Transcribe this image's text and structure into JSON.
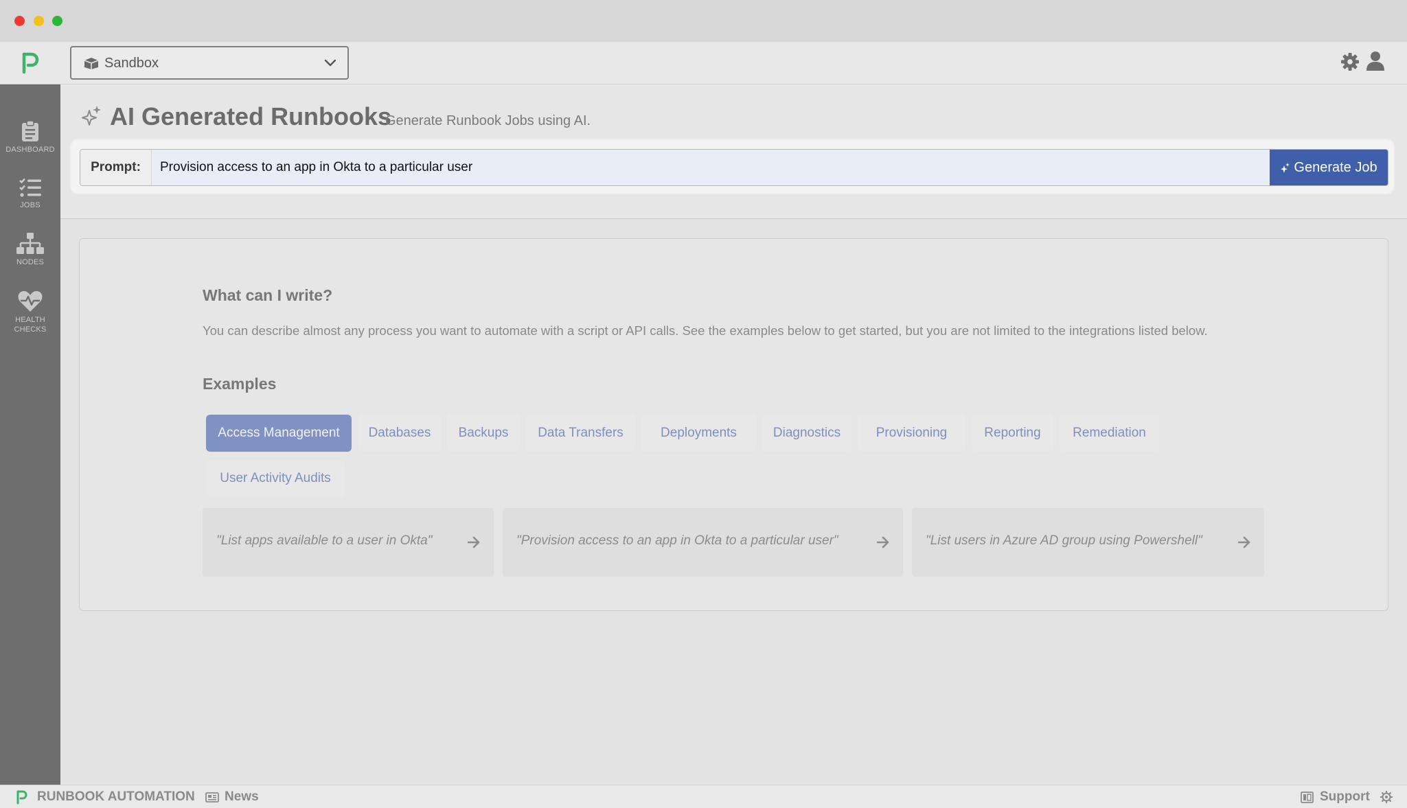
{
  "window": {
    "traffic_lights": [
      "close",
      "minimize",
      "maximize"
    ]
  },
  "topbar": {
    "environment": "Sandbox",
    "icons": [
      "gear-icon",
      "user-icon"
    ]
  },
  "sidebar": {
    "items": [
      {
        "label": "DASHBOARD",
        "icon": "clipboard-icon"
      },
      {
        "label": "JOBS",
        "icon": "list-icon"
      },
      {
        "label": "NODES",
        "icon": "sitemap-icon"
      },
      {
        "label": "HEALTH\nCHECKS",
        "icon": "heartbeat-icon"
      }
    ]
  },
  "header": {
    "title": "AI Generated Runbooks",
    "subtitle": "Generate Runbook Jobs using AI."
  },
  "prompt": {
    "label": "Prompt:",
    "value": "Provision access to an app in Okta to a particular user",
    "button": "Generate Job"
  },
  "content": {
    "heading": "What can I write?",
    "description": "You can describe almost any process you want to automate with a script or API calls. See the examples below to get started, but you are not limited to the integrations listed below.",
    "examples_heading": "Examples",
    "tabs": [
      "Access Management",
      "Databases",
      "Backups",
      "Data Transfers",
      "Deployments",
      "Diagnostics",
      "Provisioning",
      "Reporting",
      "Remediation",
      "User Activity Audits"
    ],
    "active_tab": "Access Management",
    "examples": [
      "\"List apps available to a user in Okta\"",
      "\"Provision access to an app in Okta to a particular user\"",
      "\"List users in Azure AD group using Powershell\""
    ]
  },
  "footer": {
    "brand": "RUNBOOK AUTOMATION",
    "news": "News",
    "support": "Support"
  },
  "colors": {
    "accent": "#3f5faa",
    "active_tab": "#7f92c3",
    "logo_green": "#3db36b",
    "sidebar": "#6e6e6e"
  }
}
